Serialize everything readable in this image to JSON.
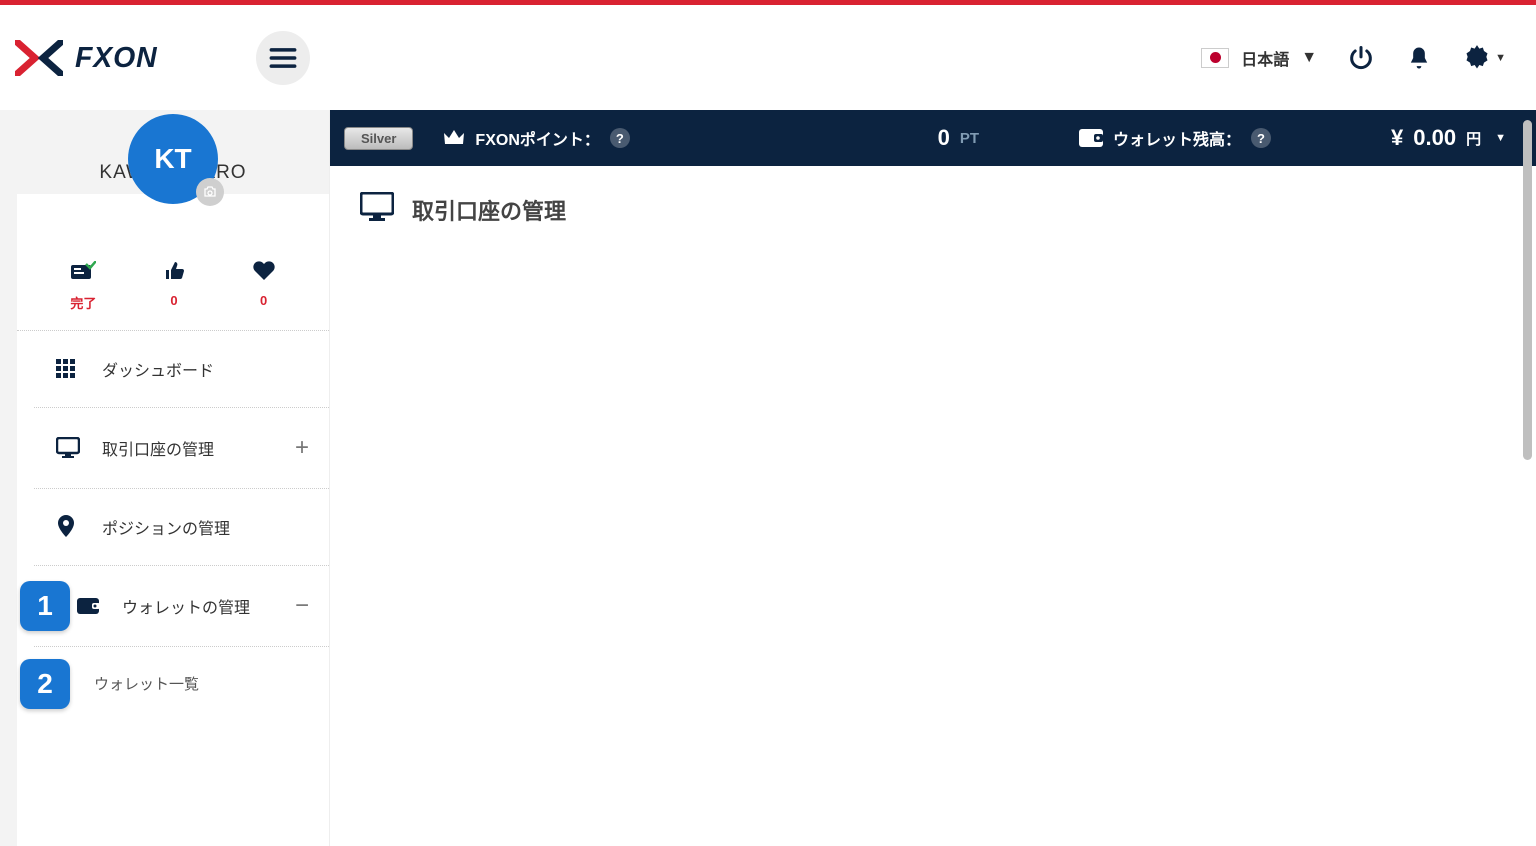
{
  "header": {
    "language_label": "日本語"
  },
  "profile": {
    "user_name": "KAWASE TARO",
    "avatar_initials": "KT",
    "stats": {
      "status_label": "完了",
      "likes": "0",
      "favorites": "0"
    }
  },
  "status_bar": {
    "tier": "Silver",
    "point_label": "FXONポイント：",
    "point_value": "0",
    "point_unit": "PT",
    "wallet_label": "ウォレット残高：",
    "wallet_currency": "¥",
    "wallet_value": "0.00",
    "wallet_unit": "円"
  },
  "nav": {
    "dashboard": "ダッシュボード",
    "accounts": "取引口座の管理",
    "positions": "ポジションの管理",
    "wallet": "ウォレットの管理",
    "wallet_list": "ウォレット一覧",
    "badge1": "1",
    "badge2": "2"
  },
  "main": {
    "page_title": "取引口座の管理"
  }
}
